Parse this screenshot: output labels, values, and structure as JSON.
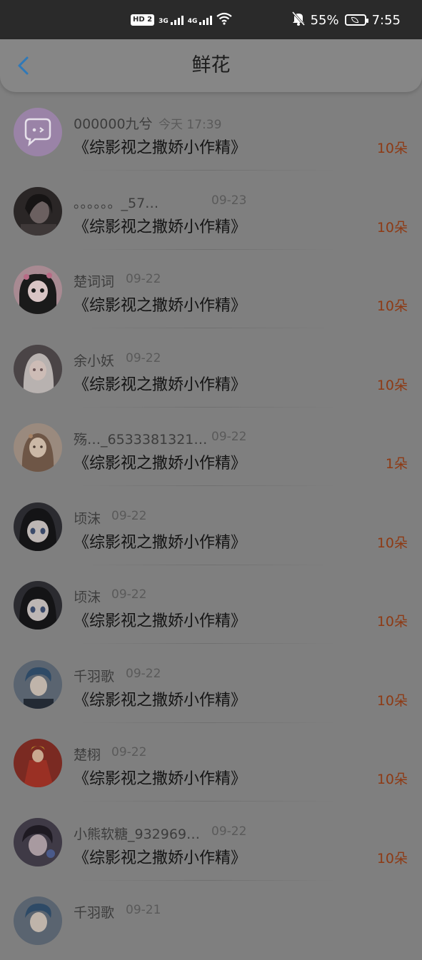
{
  "status_bar": {
    "hd_label": "HD",
    "hd_sim": "2",
    "net1_label": "3G",
    "net2_label": "4G",
    "battery_percent": "55%",
    "time": "7:55"
  },
  "header": {
    "title": "鲜花"
  },
  "items": [
    {
      "name": "000000九兮",
      "time": "今天 17:39",
      "book": "《综影视之撒娇小作精》",
      "count": "10朵"
    },
    {
      "name": "。。。。。。_57…",
      "time": "09-23",
      "book": "《综影视之撒娇小作精》",
      "count": "10朵"
    },
    {
      "name": "楚词词",
      "time": "09-22",
      "book": "《综影视之撒娇小作精》",
      "count": "10朵"
    },
    {
      "name": "余小妖",
      "time": "09-22",
      "book": "《综影视之撒娇小作精》",
      "count": "10朵"
    },
    {
      "name": "殇…_6533381321…",
      "time": "09-22",
      "book": "《综影视之撒娇小作精》",
      "count": "1朵"
    },
    {
      "name": "顷沫",
      "time": "09-22",
      "book": "《综影视之撒娇小作精》",
      "count": "10朵"
    },
    {
      "name": "顷沫",
      "time": "09-22",
      "book": "《综影视之撒娇小作精》",
      "count": "10朵"
    },
    {
      "name": "千羽歌",
      "time": "09-22",
      "book": "《综影视之撒娇小作精》",
      "count": "10朵"
    },
    {
      "name": "楚栩",
      "time": "09-22",
      "book": "《综影视之撒娇小作精》",
      "count": "10朵"
    },
    {
      "name": "小熊软糖_932969…",
      "time": "09-22",
      "book": "《综影视之撒娇小作精》",
      "count": "10朵"
    },
    {
      "name": "千羽歌",
      "time": "09-21",
      "book": "",
      "count": ""
    }
  ],
  "colors": {
    "accent_back": "#2f79b8",
    "count_text": "#8e3a14",
    "overlay_bg": "#7f7f7f",
    "status_bg": "#2a2a2a"
  }
}
